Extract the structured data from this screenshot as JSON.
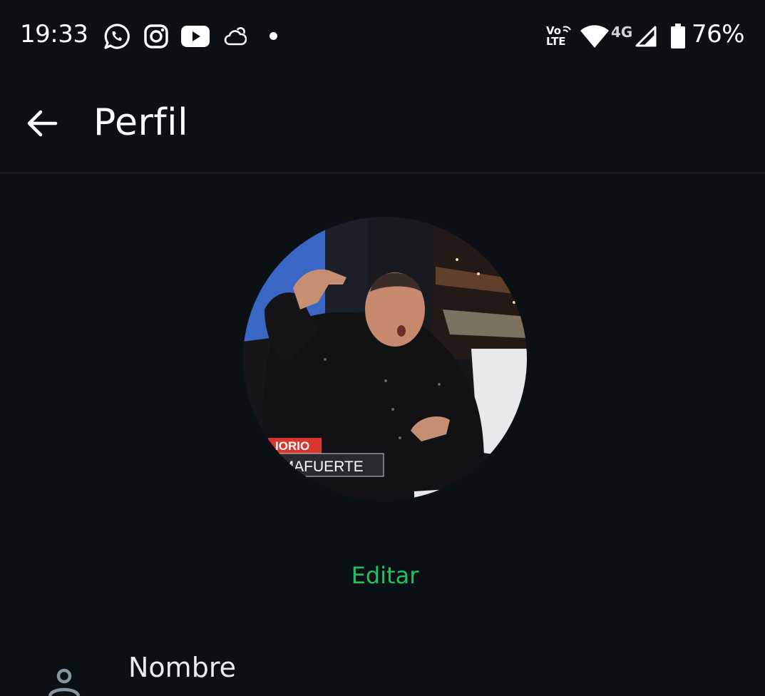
{
  "status_bar": {
    "time": "19:33",
    "notification_icons": [
      "whatsapp-icon",
      "instagram-icon",
      "youtube-icon",
      "weather-cloud-icon",
      "more-notifications-dot"
    ],
    "volte_line1": "Vo",
    "volte_line2": "LTE",
    "network_type": "4G",
    "battery_percent": "76%",
    "icons_right": [
      "volte-icon",
      "wifi-icon",
      "signal-icon",
      "battery-icon"
    ]
  },
  "app_bar": {
    "title": "Perfil",
    "back_icon": "arrow-back-icon"
  },
  "profile": {
    "photo_overlay_top": "IORIO",
    "photo_overlay_bottom": "LMAFUERTE",
    "edit_label": "Editar"
  },
  "fields": {
    "name_label": "Nombre",
    "name_icon": "person-icon"
  },
  "colors": {
    "background": "#0b1014",
    "accent": "#21c063",
    "text_primary": "#e9edef"
  }
}
